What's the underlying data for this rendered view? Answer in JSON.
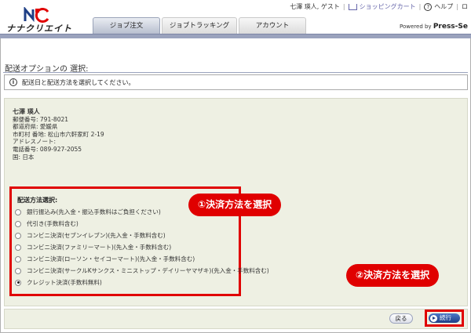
{
  "header": {
    "logo_text": "ナナクリエイト",
    "user_greeting": "七澤 瑛人, ゲスト",
    "cart_label": "ショッピングカート",
    "help_label": "ヘルプ",
    "logout_label": "ロ",
    "powered_prefix": "Powered by",
    "powered_brand": "Press-Se",
    "tabs": [
      {
        "label": "ジョブ注文",
        "active": true
      },
      {
        "label": "ジョブトラッキング",
        "active": false
      },
      {
        "label": "アカウント",
        "active": false
      }
    ]
  },
  "page": {
    "title": "配送オプションの 選択:",
    "info_message": "配送日と配送方法を選択してください。"
  },
  "address": {
    "name": "七澤 瑛人",
    "lines": [
      "郵便番号: 791-8021",
      "都道府県: 愛媛県",
      "市町村 番地: 松山市六軒家町 2-19",
      "アドレスノート:",
      "電話番号: 089-927-2055",
      "国: 日本"
    ]
  },
  "shipping": {
    "label": "配送方法選択:",
    "options": [
      {
        "label": "銀行振込み(先入金・振込手数料はご負担ください)",
        "selected": false
      },
      {
        "label": "代引き(手数料含む)",
        "selected": false
      },
      {
        "label": "コンビニ決済(セブンイレブン)(先入金・手数料含む)",
        "selected": false
      },
      {
        "label": "コンビニ決済(ファミリーマート)(先入金・手数料含む)",
        "selected": false
      },
      {
        "label": "コンビニ決済(ローソン・セイコーマート)(先入金・手数料含む)",
        "selected": false
      },
      {
        "label": "コンビニ決済(サークルKサンクス・ミニストップ・デイリーヤマザキ)(先入金・手数料含む)",
        "selected": false
      },
      {
        "label": "クレジット決済(手数料無料)",
        "selected": true
      }
    ]
  },
  "callouts": {
    "step1": "①決済方法を選択",
    "step2": "②決済方法を選択"
  },
  "buttons": {
    "back": "戻る",
    "next": "続行"
  },
  "colors": {
    "highlight": "#e00000",
    "nav": "#9aa2bd",
    "panel_bg": "#eef0e3"
  }
}
